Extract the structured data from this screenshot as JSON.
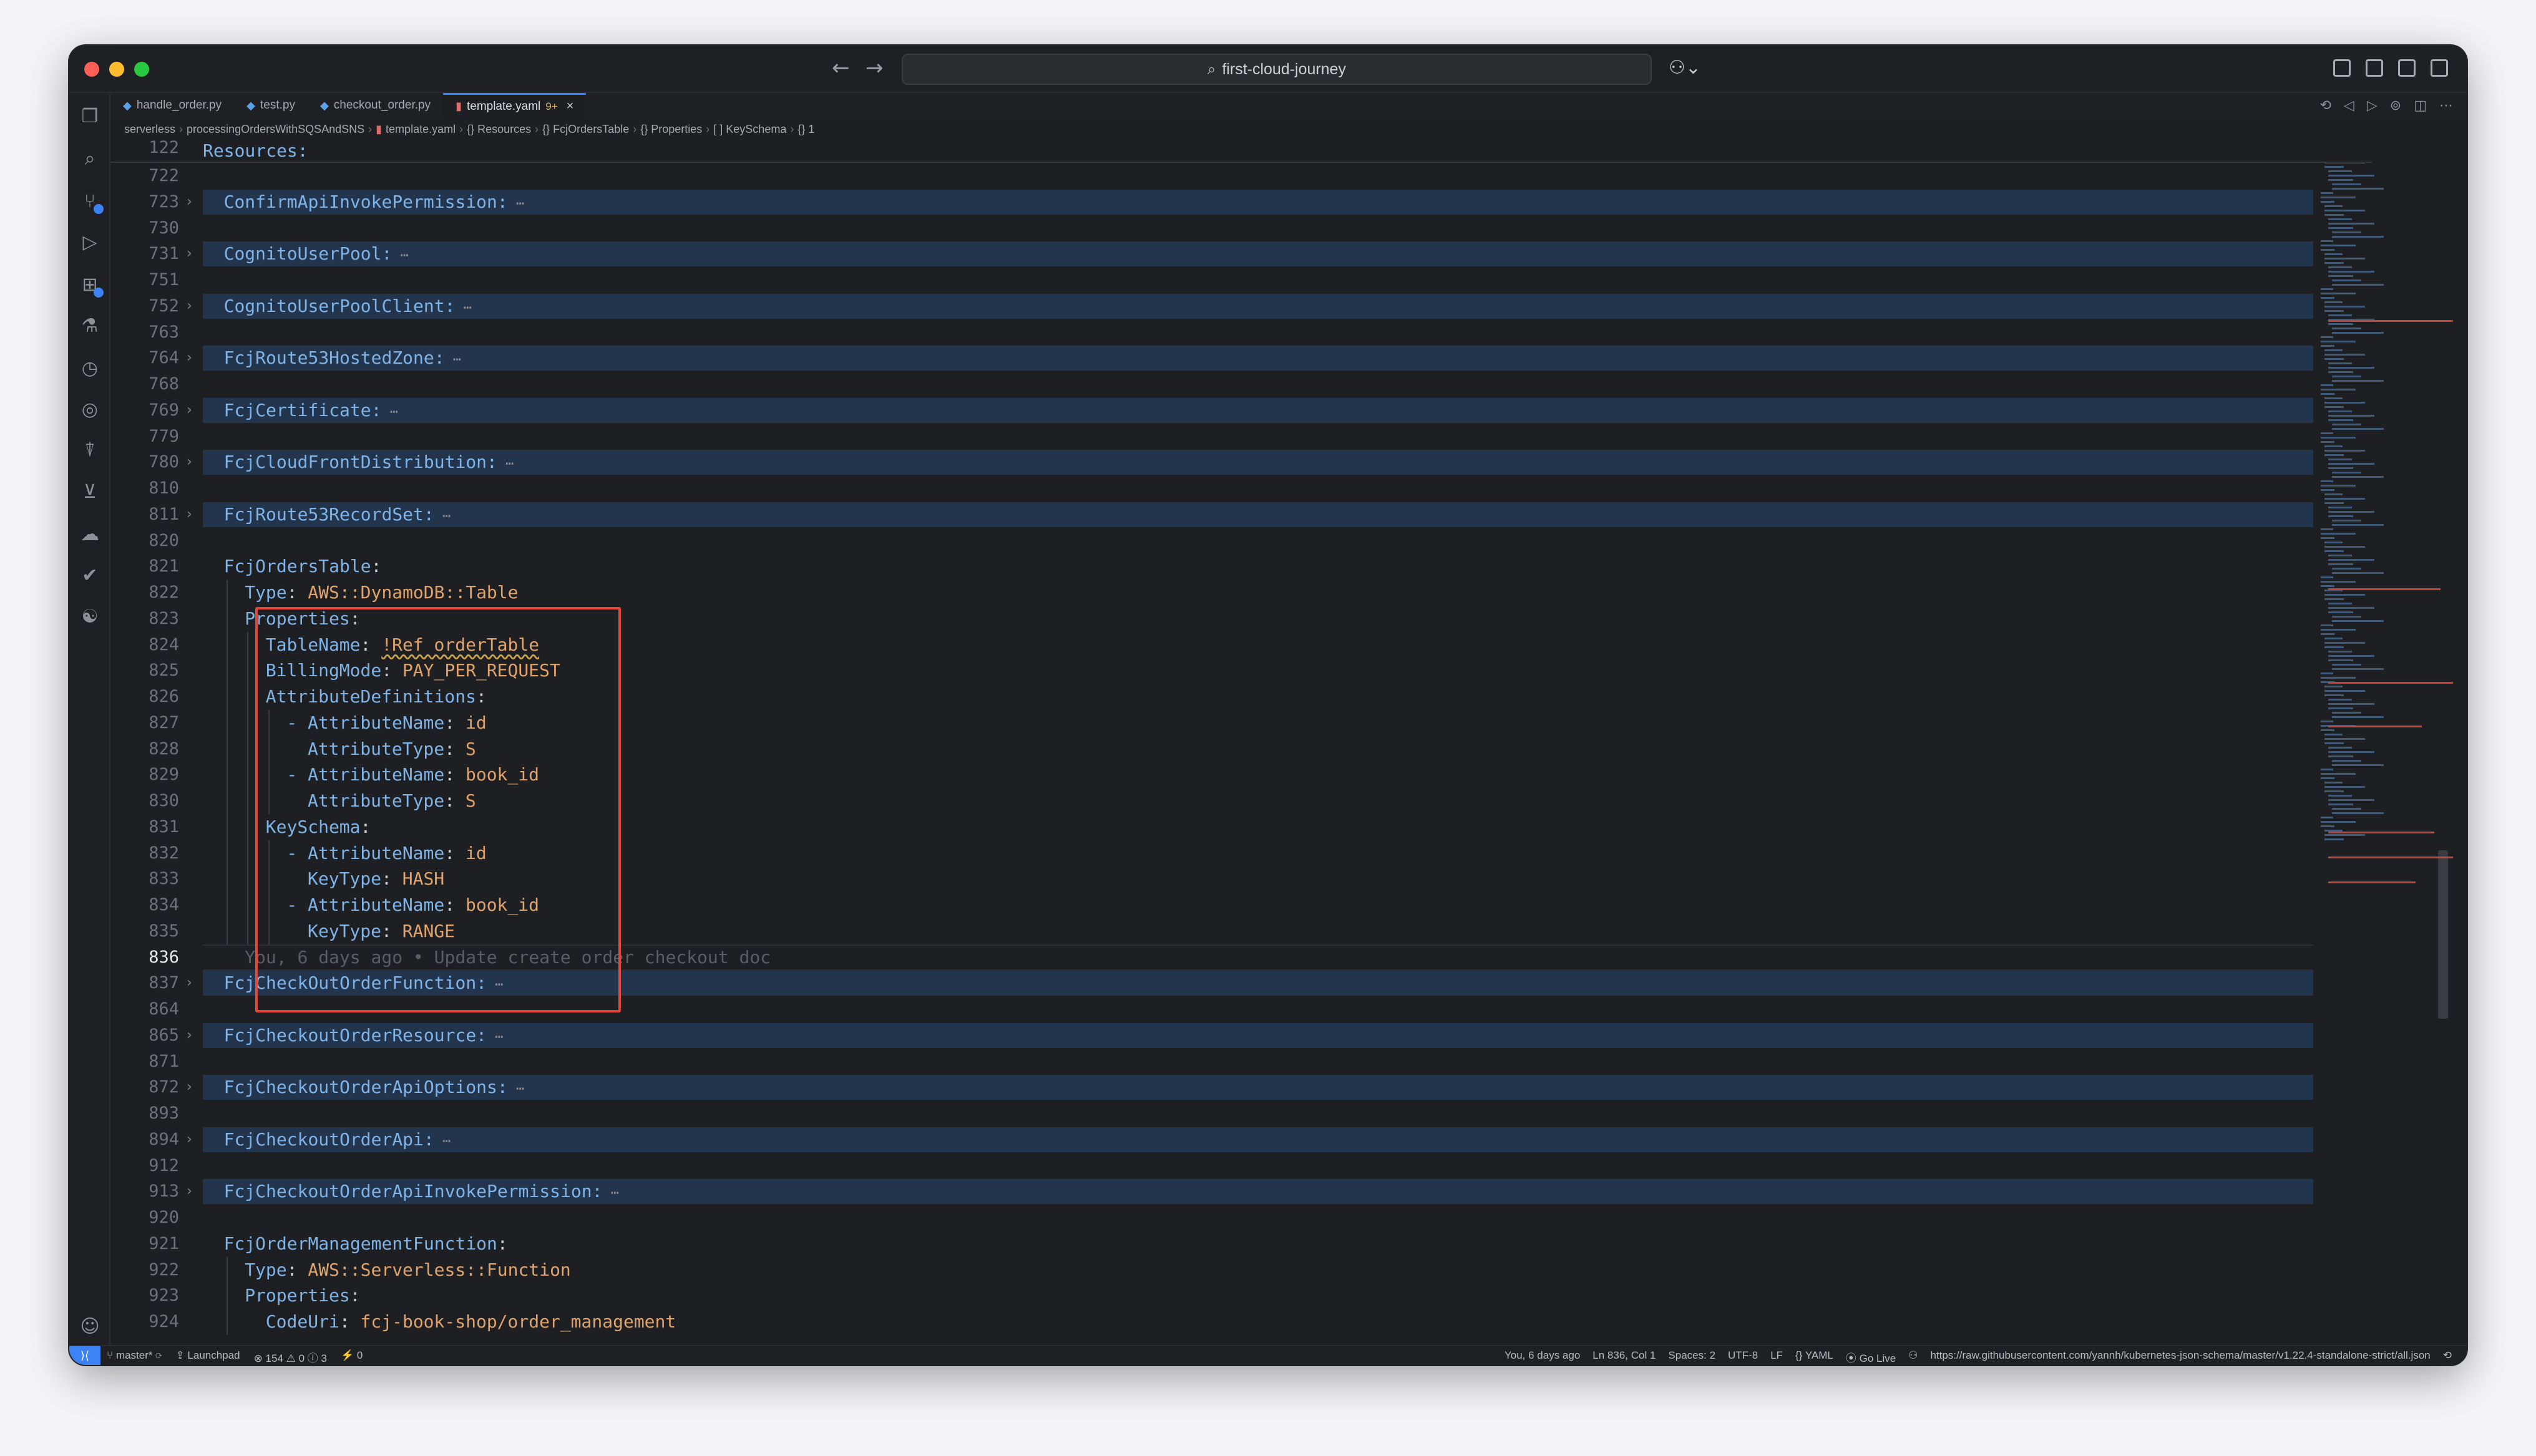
{
  "titlebar": {
    "search_text": "first-cloud-journey",
    "back_icon": "arrow-left-icon",
    "forward_icon": "arrow-right-icon"
  },
  "tabs": [
    {
      "label": "handle_order.py",
      "icon": "python-icon"
    },
    {
      "label": "test.py",
      "icon": "python-icon"
    },
    {
      "label": "checkout_order.py",
      "icon": "python-icon"
    },
    {
      "label": "template.yaml",
      "icon": "yaml-icon",
      "modified": "9+",
      "active": true
    }
  ],
  "breadcrumb": [
    "serverless",
    "processingOrdersWithSQSAndSNS",
    "template.yaml",
    "{} Resources",
    "{} FcjOrdersTable",
    "{} Properties",
    "[ ] KeySchema",
    "{} 1"
  ],
  "sticky": {
    "line": "122",
    "text": "Resources:"
  },
  "folded_lines": [
    {
      "line": "723",
      "key": "ConfirmApiInvokePermission:"
    },
    {
      "line": "731",
      "key": "CognitoUserPool:"
    },
    {
      "line": "752",
      "key": "CognitoUserPoolClient:"
    },
    {
      "line": "764",
      "key": "FcjRoute53HostedZone:"
    },
    {
      "line": "769",
      "key": "FcjCertificate:"
    },
    {
      "line": "780",
      "key": "FcjCloudFrontDistribution:"
    },
    {
      "line": "811",
      "key": "FcjRoute53RecordSet:"
    },
    {
      "line": "837",
      "key": "FcjCheckOutOrderFunction:"
    },
    {
      "line": "865",
      "key": "FcjCheckoutOrderResource:"
    },
    {
      "line": "872",
      "key": "FcjCheckoutOrderApiOptions:"
    },
    {
      "line": "894",
      "key": "FcjCheckoutOrderApi:"
    },
    {
      "line": "913",
      "key": "FcjCheckoutOrderApiInvokePermission:"
    }
  ],
  "blank_lines": [
    "722",
    "730",
    "751",
    "763",
    "768",
    "779",
    "810",
    "820",
    "864",
    "871",
    "893",
    "912",
    "920"
  ],
  "code_lines": [
    {
      "line": "821",
      "key": "FcjOrdersTable",
      "value": ""
    },
    {
      "line": "822",
      "key": "Type",
      "value": "AWS::DynamoDB::Table"
    },
    {
      "line": "823",
      "key": "Properties",
      "value": ""
    },
    {
      "line": "824",
      "key": "TableName",
      "value": "!Ref orderTable"
    },
    {
      "line": "825",
      "key": "BillingMode",
      "value": "PAY_PER_REQUEST"
    },
    {
      "line": "826",
      "key": "AttributeDefinitions",
      "value": ""
    },
    {
      "line": "827",
      "key": "- AttributeName",
      "value": "id"
    },
    {
      "line": "828",
      "key": "AttributeType",
      "value": "S"
    },
    {
      "line": "829",
      "key": "- AttributeName",
      "value": "book_id"
    },
    {
      "line": "830",
      "key": "AttributeType",
      "value": "S"
    },
    {
      "line": "831",
      "key": "KeySchema",
      "value": ""
    },
    {
      "line": "832",
      "key": "- AttributeName",
      "value": "id"
    },
    {
      "line": "833",
      "key": "KeyType",
      "value": "HASH"
    },
    {
      "line": "834",
      "key": "- AttributeName",
      "value": "book_id"
    },
    {
      "line": "835",
      "key": "KeyType",
      "value": "RANGE"
    },
    {
      "line": "921",
      "key": "FcjOrderManagementFunction",
      "value": ""
    },
    {
      "line": "922",
      "key": "Type",
      "value": "AWS::Serverless::Function"
    },
    {
      "line": "923",
      "key": "Properties",
      "value": ""
    },
    {
      "line": "924",
      "key": "CodeUri",
      "value": "fcj-book-shop/order_management"
    }
  ],
  "current_line": {
    "line": "836",
    "blame": "You, 6 days ago • Update create order checkout doc"
  },
  "statusbar": {
    "branch": "master*",
    "launchpad": "Launchpad",
    "problems": "⊗ 154 ⚠ 0 ⓘ 3",
    "ports": "⚡ 0",
    "blame": "You, 6 days ago",
    "position": "Ln 836, Col 1",
    "spaces": "Spaces: 2",
    "encoding": "UTF-8",
    "eol": "LF",
    "language": "{} YAML",
    "golive": "Go Live",
    "schema": "https://raw.githubusercontent.com/yannh/kubernetes-json-schema/master/v1.22.4-standalone-strict/all.json"
  },
  "colors": {
    "highlight_box": "#e5483b",
    "accent": "#3b82f6",
    "fold_band": "#23344d"
  }
}
